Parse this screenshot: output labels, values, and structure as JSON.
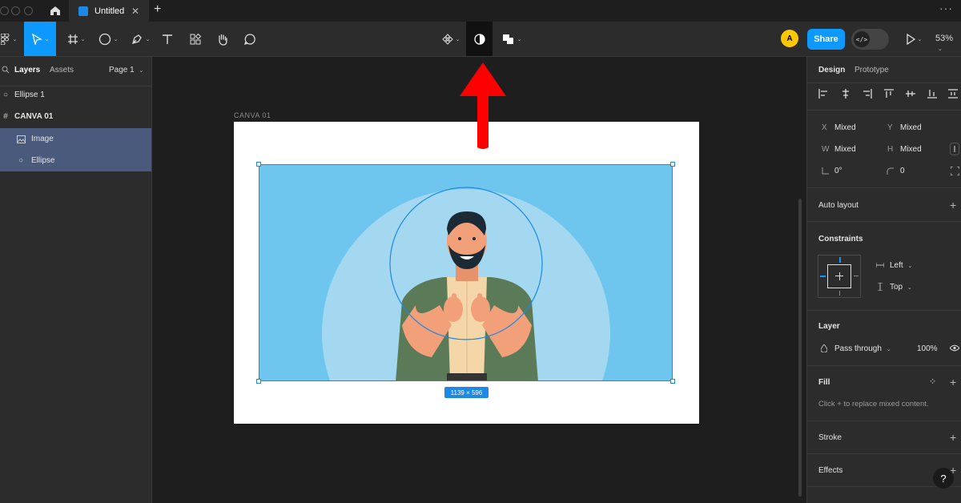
{
  "tab": {
    "title": "Untitled"
  },
  "toolbar": {
    "share_label": "Share",
    "avatar_initial": "A",
    "zoom": "53%"
  },
  "left_panel": {
    "tabs": [
      "Layers",
      "Assets"
    ],
    "page_selector": "Page 1",
    "layers": [
      {
        "name": "Ellipse 1",
        "icon": "ellipse-icon"
      },
      {
        "name": "CANVA 01",
        "icon": "frame-icon"
      },
      {
        "name": "Image",
        "icon": "image-icon"
      },
      {
        "name": "Ellipse",
        "icon": "ellipse-icon"
      }
    ]
  },
  "canvas": {
    "frame_label": "CANVA 01",
    "selection_size": "1139 × 596"
  },
  "right_panel": {
    "tabs": [
      "Design",
      "Prototype"
    ],
    "x_label": "X",
    "x_value": "Mixed",
    "y_label": "Y",
    "y_value": "Mixed",
    "w_label": "W",
    "w_value": "Mixed",
    "h_label": "H",
    "h_value": "Mixed",
    "rotation": "0°",
    "radius": "0",
    "auto_layout": "Auto layout",
    "constraints": "Constraints",
    "constraint_h": "Left",
    "constraint_v": "Top",
    "layer": "Layer",
    "blend_mode": "Pass through",
    "opacity": "100%",
    "fill": "Fill",
    "fill_hint": "Click + to replace mixed content.",
    "stroke": "Stroke",
    "effects": "Effects",
    "help": "?"
  },
  "colors": {
    "accent": "#0d99ff",
    "image_bg": "#6ec6ee",
    "arrow": "#ff0000"
  }
}
